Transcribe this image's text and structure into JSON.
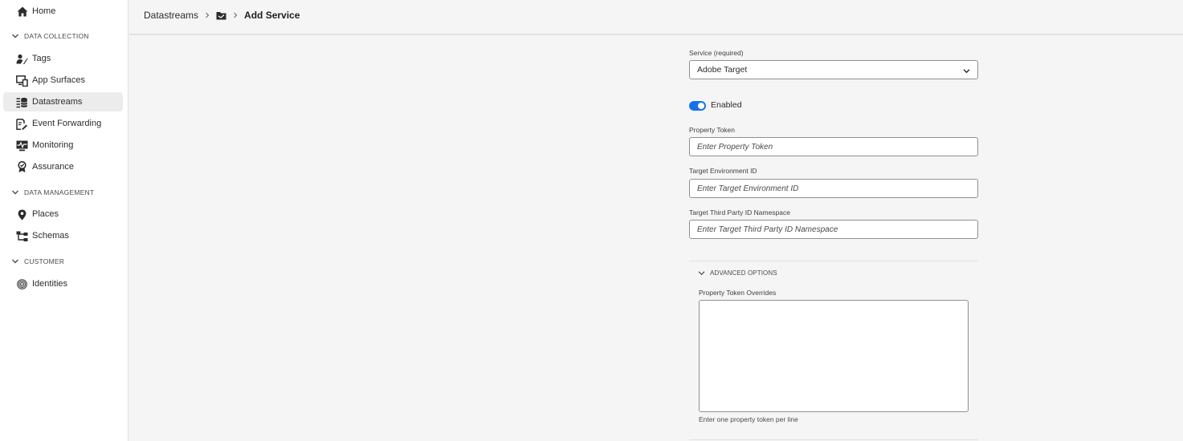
{
  "sidebar": {
    "home": {
      "label": "Home",
      "icon": "home-icon"
    },
    "sections": [
      {
        "title": "DATA COLLECTION",
        "items": [
          {
            "label": "Tags",
            "icon": "tags-icon"
          },
          {
            "label": "App Surfaces",
            "icon": "app-surfaces-icon"
          },
          {
            "label": "Datastreams",
            "icon": "datastreams-icon",
            "selected": true
          },
          {
            "label": "Event Forwarding",
            "icon": "event-forwarding-icon"
          },
          {
            "label": "Monitoring",
            "icon": "monitoring-icon"
          },
          {
            "label": "Assurance",
            "icon": "assurance-icon"
          }
        ]
      },
      {
        "title": "DATA MANAGEMENT",
        "items": [
          {
            "label": "Places",
            "icon": "places-icon"
          },
          {
            "label": "Schemas",
            "icon": "schemas-icon"
          }
        ]
      },
      {
        "title": "CUSTOMER",
        "items": [
          {
            "label": "Identities",
            "icon": "identities-icon"
          }
        ]
      }
    ]
  },
  "breadcrumb": {
    "root": "Datastreams",
    "folder_icon": "folder-icon",
    "current": "Add Service"
  },
  "form": {
    "service": {
      "label": "Service (required)",
      "value": "Adobe Target"
    },
    "enabled": {
      "label": "Enabled",
      "on": true
    },
    "property_token": {
      "label": "Property Token",
      "placeholder": "Enter Property Token"
    },
    "target_env": {
      "label": "Target Environment ID",
      "placeholder": "Enter Target Environment ID"
    },
    "third_party": {
      "label": "Target Third Party ID Namespace",
      "placeholder": "Enter Target Third Party ID Namespace"
    },
    "advanced": {
      "title": "ADVANCED OPTIONS",
      "overrides_label": "Property Token Overrides",
      "overrides_help": "Enter one property token per line"
    }
  },
  "colors": {
    "accent": "#1473e6",
    "sidebar_bg": "#ffffff",
    "content_bg": "#f5f5f5",
    "selected_bg": "#ececec"
  }
}
